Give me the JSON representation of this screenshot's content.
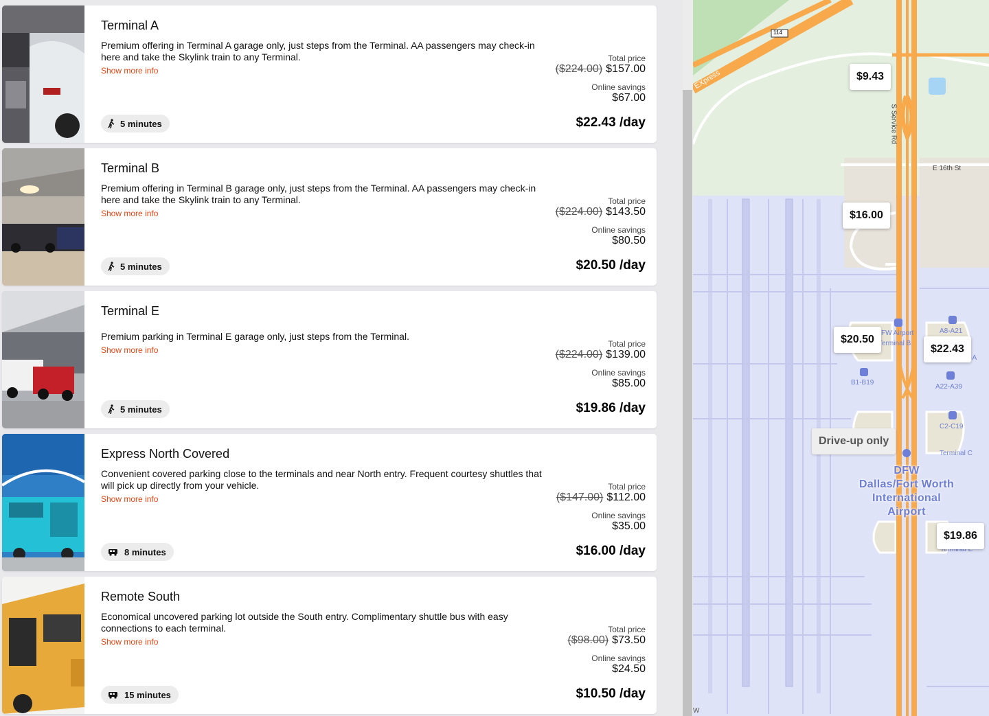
{
  "listings": [
    {
      "name": "Terminal A",
      "description": "Premium offering in Terminal A garage only, just steps from the Terminal. AA passengers may check-in here and take the Skylink train to any Terminal.",
      "more_label": "Show more info",
      "transit": "walk",
      "transit_icon": "walking-icon",
      "time": "5 minutes",
      "total_label": "Total price",
      "original_price": "($224.00)",
      "total_price": "$157.00",
      "savings_label": "Online savings",
      "savings": "$67.00",
      "per_day": "$22.43 /day"
    },
    {
      "name": "Terminal B",
      "description": "Premium offering in Terminal B garage only, just steps from the Terminal. AA passengers may check-in here and take the Skylink train to any Terminal.",
      "more_label": "Show more info",
      "transit": "walk",
      "transit_icon": "walking-icon",
      "time": "5 minutes",
      "total_label": "Total price",
      "original_price": "($224.00)",
      "total_price": "$143.50",
      "savings_label": "Online savings",
      "savings": "$80.50",
      "per_day": "$20.50 /day"
    },
    {
      "name": "Terminal E",
      "description": "Premium parking in Terminal E garage only, just steps from the Terminal.",
      "more_label": "Show more info",
      "transit": "walk",
      "transit_icon": "walking-icon",
      "time": "5 minutes",
      "total_label": "Total price",
      "original_price": "($224.00)",
      "total_price": "$139.00",
      "savings_label": "Online savings",
      "savings": "$85.00",
      "per_day": "$19.86 /day"
    },
    {
      "name": "Express North Covered",
      "description": "Convenient covered parking close to the terminals and near North entry. Frequent courtesy shuttles that will pick up directly from your vehicle.",
      "more_label": "Show more info",
      "transit": "shuttle",
      "transit_icon": "shuttle-icon",
      "time": "8 minutes",
      "total_label": "Total price",
      "original_price": "($147.00)",
      "total_price": "$112.00",
      "savings_label": "Online savings",
      "savings": "$35.00",
      "per_day": "$16.00 /day"
    },
    {
      "name": "Remote South",
      "description": "Economical uncovered parking lot outside the South entry. Complimentary shuttle bus with easy connections to each terminal.",
      "more_label": "Show more info",
      "transit": "shuttle",
      "transit_icon": "shuttle-icon",
      "time": "15 minutes",
      "total_label": "Total price",
      "original_price": "($98.00)",
      "total_price": "$73.50",
      "savings_label": "Online savings",
      "savings": "$24.50",
      "per_day": "$10.50 /day"
    }
  ],
  "map": {
    "pins": [
      "$9.43",
      "$16.00",
      "$20.50",
      "$22.43",
      "$19.86"
    ],
    "drive_up": "Drive-up only",
    "road_labels": {
      "highway": "114",
      "express": "EXpress",
      "service_rd": "S Service Rd",
      "street": "E 16th St"
    },
    "airport_name": "DFW\nDallas/Fort Worth\nInternational\nAirport",
    "terminal_labels": {
      "fw_airport": "FW Airport",
      "terminal_b": "Terminal B",
      "a8_a21": "A8-A21",
      "terminal_a_partial": "l A",
      "b1_b19": "B1-B19",
      "a22_a39": "A22-A39",
      "c2_c19": "C2-C19",
      "terminal_c": "Terminal C",
      "terminal_e_partial": "Terminal E",
      "w_partial": "W"
    },
    "colors": {
      "highway": "#f7a94b",
      "airport_area": "#dfe3f7",
      "grass": "#e4efe0",
      "accent": "#e44411"
    }
  }
}
